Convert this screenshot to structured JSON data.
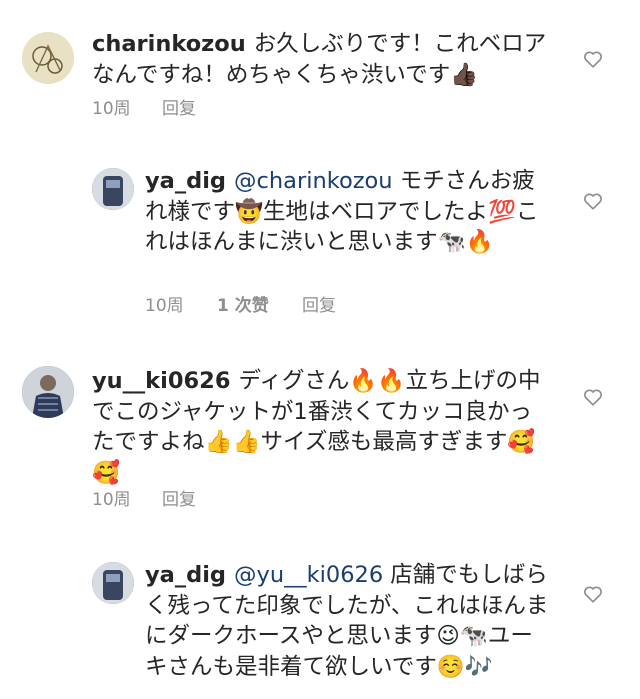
{
  "comments": [
    {
      "username": "charinkozou",
      "mention": "",
      "text": "お久しぶりです！これベロアなんですね！めちゃくちゃ渋いです👍🏿",
      "time": "10周",
      "likes": "",
      "reply": "回复"
    },
    {
      "username": "ya_dig",
      "mention": "@charinkozou",
      "text": " モチさんお疲れ様です🤠生地はベロアでしたよ💯これはほんまに渋いと思います🐄🔥",
      "time": "10周",
      "likes": "1 次赞",
      "reply": "回复"
    },
    {
      "username": "yu__ki0626",
      "mention": "",
      "text": "ディグさん🔥🔥立ち上げの中でこのジャケットが1番渋くてカッコ良かったですよね👍👍サイズ感も最高すぎます🥰🥰",
      "time": "10周",
      "likes": "",
      "reply": "回复"
    },
    {
      "username": "ya_dig",
      "mention": "@yu__ki0626",
      "text": " 店舗でもしばらく残ってた印象でしたが、これはほんまにダークホースやと思います😉🐄ユーキさんも是非着て欲しいです☺️🎶",
      "time": "",
      "likes": "",
      "reply": ""
    }
  ],
  "icons": {
    "like": "heart-outline-icon"
  }
}
